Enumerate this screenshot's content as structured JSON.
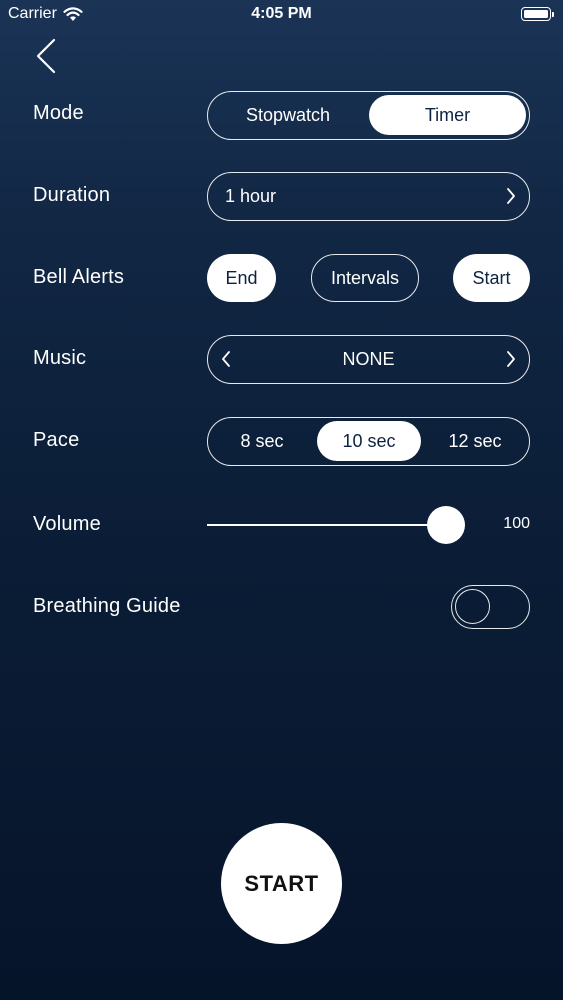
{
  "status": {
    "carrier": "Carrier",
    "time": "4:05 PM"
  },
  "mode": {
    "label": "Mode",
    "options": [
      "Stopwatch",
      "Timer"
    ],
    "selected": "Timer"
  },
  "duration": {
    "label": "Duration",
    "value": "1 hour"
  },
  "bell_alerts": {
    "label": "Bell Alerts",
    "options": [
      {
        "label": "End",
        "on": true
      },
      {
        "label": "Intervals",
        "on": false
      },
      {
        "label": "Start",
        "on": true
      }
    ]
  },
  "music": {
    "label": "Music",
    "value": "NONE"
  },
  "pace": {
    "label": "Pace",
    "options": [
      "8 sec",
      "10 sec",
      "12 sec"
    ],
    "selected": "10 sec"
  },
  "volume": {
    "label": "Volume",
    "value": "100",
    "level": 1.0
  },
  "breathing_guide": {
    "label": "Breathing Guide",
    "enabled": false
  },
  "start_button": {
    "label": "START"
  },
  "colors": {
    "background_top": "#1b3456",
    "background_bottom": "#06142a",
    "selected_text": "#0e2240"
  }
}
